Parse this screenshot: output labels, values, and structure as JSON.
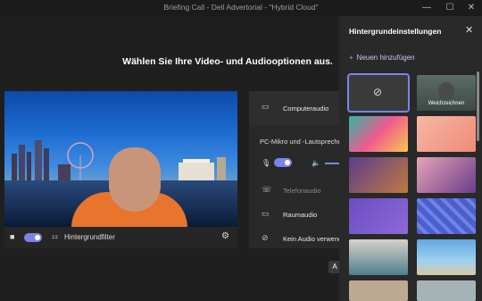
{
  "window": {
    "title": "Briefing Call - Dell Advertorial - \"Hybrid Cloud\""
  },
  "main": {
    "heading": "Wählen Sie Ihre Video- und Audiooptionen aus."
  },
  "video_controls": {
    "camera_on": true,
    "background_filter_label": "Hintergrundfilter"
  },
  "audio": {
    "computer_audio_label": "Computeraudio",
    "device_label": "PC-Mikro und -Lautsprecher",
    "mic_on": true,
    "phone_audio_label": "Telefonaudio",
    "room_audio_label": "Raumaudio",
    "no_audio_label": "Kein Audio verwenden"
  },
  "next_button_label": "A",
  "background_panel": {
    "title": "Hintergrundeinstellungen",
    "add_new_label": "Neuen hinzufügen",
    "tiles": [
      {
        "name": "none",
        "label": ""
      },
      {
        "name": "blur",
        "label": "Weichzeichnen"
      },
      {
        "name": "colorful-landscape",
        "label": ""
      },
      {
        "name": "pink-room",
        "label": ""
      },
      {
        "name": "purple-interior",
        "label": ""
      },
      {
        "name": "pink-shelves",
        "label": ""
      },
      {
        "name": "purple-wall",
        "label": ""
      },
      {
        "name": "blue-pattern",
        "label": ""
      },
      {
        "name": "modern-room",
        "label": ""
      },
      {
        "name": "beach-cars",
        "label": ""
      }
    ]
  }
}
